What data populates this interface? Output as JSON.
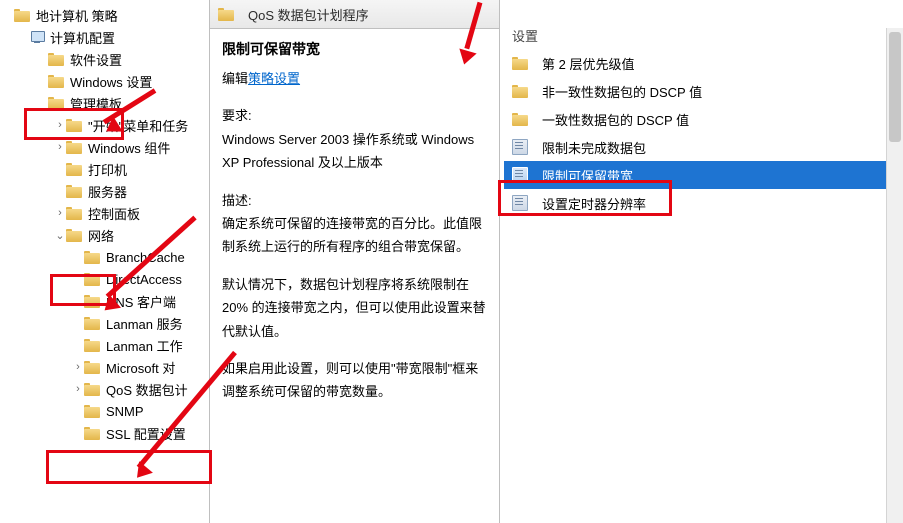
{
  "tree": {
    "root": "地计算机 策略",
    "computer_config": "计算机配置",
    "items": [
      {
        "label": "软件设置",
        "indent": 2,
        "exp": "",
        "icon": "folder"
      },
      {
        "label": "Windows 设置",
        "indent": 2,
        "exp": "",
        "icon": "folder"
      },
      {
        "label": "管理模板",
        "indent": 2,
        "exp": "",
        "icon": "folder"
      },
      {
        "label": "\"开始\"菜单和任务",
        "indent": 3,
        "exp": ">",
        "icon": "folder"
      },
      {
        "label": "Windows 组件",
        "indent": 3,
        "exp": ">",
        "icon": "folder"
      },
      {
        "label": "打印机",
        "indent": 3,
        "exp": "",
        "icon": "folder"
      },
      {
        "label": "服务器",
        "indent": 3,
        "exp": "",
        "icon": "folder"
      },
      {
        "label": "控制面板",
        "indent": 3,
        "exp": ">",
        "icon": "folder"
      },
      {
        "label": "网络",
        "indent": 3,
        "exp": "v",
        "icon": "folder"
      },
      {
        "label": "BranchCache",
        "indent": 4,
        "exp": "",
        "icon": "folder"
      },
      {
        "label": "DirectAccess",
        "indent": 4,
        "exp": "",
        "icon": "folder"
      },
      {
        "label": "DNS 客户端",
        "indent": 4,
        "exp": "",
        "icon": "folder"
      },
      {
        "label": "Lanman 服务",
        "indent": 4,
        "exp": "",
        "icon": "folder"
      },
      {
        "label": "Lanman 工作",
        "indent": 4,
        "exp": "",
        "icon": "folder"
      },
      {
        "label": "Microsoft 对",
        "indent": 4,
        "exp": ">",
        "icon": "folder"
      },
      {
        "label": "QoS 数据包计",
        "indent": 4,
        "exp": ">",
        "icon": "folder"
      },
      {
        "label": "SNMP",
        "indent": 4,
        "exp": "",
        "icon": "folder"
      },
      {
        "label": "SSL 配置设置",
        "indent": 4,
        "exp": "",
        "icon": "folder"
      }
    ]
  },
  "pathbar": {
    "title": "QoS 数据包计划程序"
  },
  "mid": {
    "heading": "限制可保留带宽",
    "edit_prefix": "编辑",
    "edit_link": "策略设置",
    "req_label": "要求:",
    "req_body": "Windows Server 2003 操作系统或 Windows XP Professional 及以上版本",
    "desc_label": "描述:",
    "desc_p1": "确定系统可保留的连接带宽的百分比。此值限制系统上运行的所有程序的组合带宽保留。",
    "desc_p2": "默认情况下，数据包计划程序将系统限制在 20% 的连接带宽之内，但可以使用此设置来替代默认值。",
    "desc_p3": "如果启用此设置，则可以使用\"带宽限制\"框来调整系统可保留的带宽数量。"
  },
  "right": {
    "header": "设置",
    "items": [
      {
        "label": "第 2 层优先级值",
        "icon": "folder",
        "selected": false
      },
      {
        "label": "非一致性数据包的 DSCP 值",
        "icon": "folder",
        "selected": false
      },
      {
        "label": "一致性数据包的 DSCP 值",
        "icon": "folder",
        "selected": false
      },
      {
        "label": "限制未完成数据包",
        "icon": "policy",
        "selected": false
      },
      {
        "label": "限制可保留带宽",
        "icon": "policy",
        "selected": true
      },
      {
        "label": "设置定时器分辨率",
        "icon": "policy",
        "selected": false
      }
    ]
  }
}
